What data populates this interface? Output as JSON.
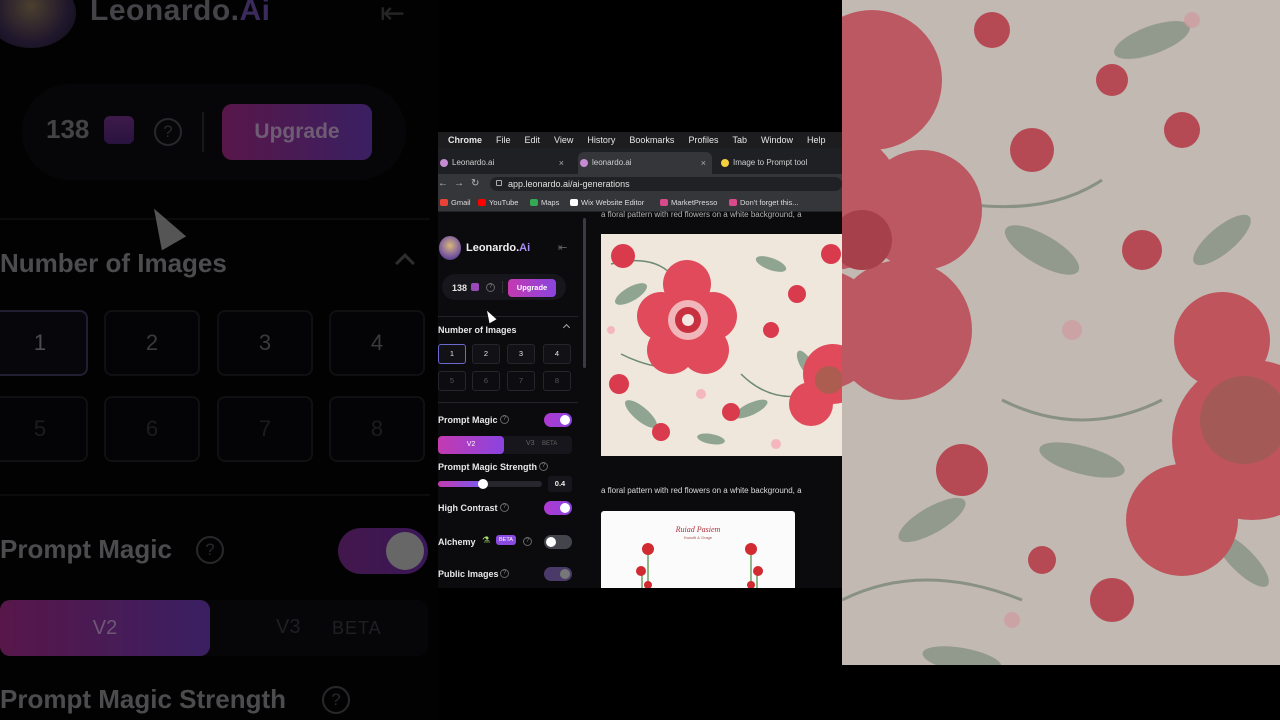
{
  "zoom_panel": {
    "brand_name": "Leonardo.",
    "brand_ai": "Ai",
    "collapse_glyph": "⇤",
    "credits": "138",
    "help_glyph": "?",
    "upgrade_label": "Upgrade",
    "number_of_images_label": "Number of Images",
    "numbers": [
      "1",
      "2",
      "3",
      "4",
      "5",
      "6",
      "7",
      "8"
    ],
    "prompt_magic_label": "Prompt Magic",
    "v2_label": "V2",
    "v3_label": "V3",
    "beta_label": "BETA",
    "prompt_magic_strength_label": "Prompt Magic Strength"
  },
  "menubar": {
    "apple": "",
    "items": [
      "Chrome",
      "File",
      "Edit",
      "View",
      "History",
      "Bookmarks",
      "Profiles",
      "Tab",
      "Window",
      "Help"
    ]
  },
  "tabs": [
    {
      "label": "Leonardo.ai",
      "close": "×"
    },
    {
      "label": "leonardo.ai",
      "close": "×"
    },
    {
      "label": "Image to Prompt tool"
    }
  ],
  "address_bar": {
    "back": "←",
    "forward": "→",
    "reload": "↻",
    "url": "app.leonardo.ai/ai-generations"
  },
  "bookmarks": [
    {
      "label": "Gmail",
      "color": "#ea4335"
    },
    {
      "label": "YouTube",
      "color": "#ff0000"
    },
    {
      "label": "Maps",
      "color": "#34a853"
    },
    {
      "label": "Wix Website Editor",
      "color": "#ffffff"
    },
    {
      "label": "MarketPresso",
      "color": "#d94a8c"
    },
    {
      "label": "Don't forget this...",
      "color": "#d94a8c"
    }
  ],
  "sidebar": {
    "brand_name": "Leonardo.",
    "brand_ai": "Ai",
    "collapse_glyph": "⇤",
    "credits": "138",
    "help_glyph": "?",
    "upgrade_label": "Upgrade",
    "number_of_images_label": "Number of Images",
    "numbers": [
      "1",
      "2",
      "3",
      "4",
      "5",
      "6",
      "7",
      "8"
    ],
    "prompt_magic_label": "Prompt Magic",
    "v2_label": "V2",
    "v3_label": "V3",
    "beta_label": "BETA",
    "prompt_magic_strength_label": "Prompt Magic Strength",
    "strength_value": "0.4",
    "strength_fraction": 0.4,
    "high_contrast_label": "High Contrast",
    "alchemy_label": "Alchemy",
    "alchemy_badge": "BETA",
    "public_images_label": "Public Images"
  },
  "main": {
    "prompt_1": "a floral pattern with red flowers on a white background, a",
    "prompt_2": "a floral pattern with red flowers on a white background, a",
    "card_title": "Ruiad Pasiem",
    "card_subtitle": "Kwadtt & Grage"
  },
  "colors": {
    "accent_start": "#c33ab0",
    "accent_end": "#8a44e0",
    "flower_red": "#e04a5a",
    "leaf_green": "#7f9a86",
    "background_cream": "#efe7dc"
  }
}
